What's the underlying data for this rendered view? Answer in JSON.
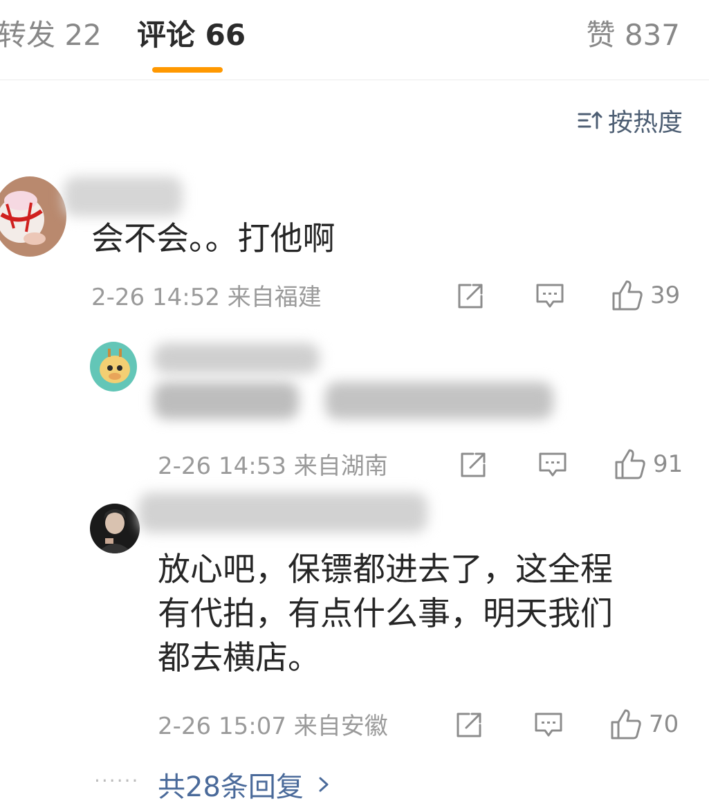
{
  "tabs": {
    "repost": "转发 22",
    "comments": "评论 66",
    "likes": "赞 837"
  },
  "sort": {
    "label": "按热度",
    "icon": "sort-icon"
  },
  "comments": [
    {
      "content": "会不会。。打他啊",
      "time": "2-26 14:52",
      "location": "来自福建",
      "likes": "39"
    },
    {
      "time": "2-26 14:53",
      "location": "来自湖南",
      "likes": "91"
    },
    {
      "content_lines": [
        "放心吧，保镖都进去了，这全程",
        "有代拍，有点什么事，明天我们",
        "都去横店。"
      ],
      "time": "2-26 15:07",
      "location": "来自安徽",
      "likes": "70"
    }
  ],
  "more_replies": "共28条回复",
  "colors": {
    "accent": "#ff9800",
    "link": "#4a6a9a",
    "meta": "#9a9a9a"
  }
}
